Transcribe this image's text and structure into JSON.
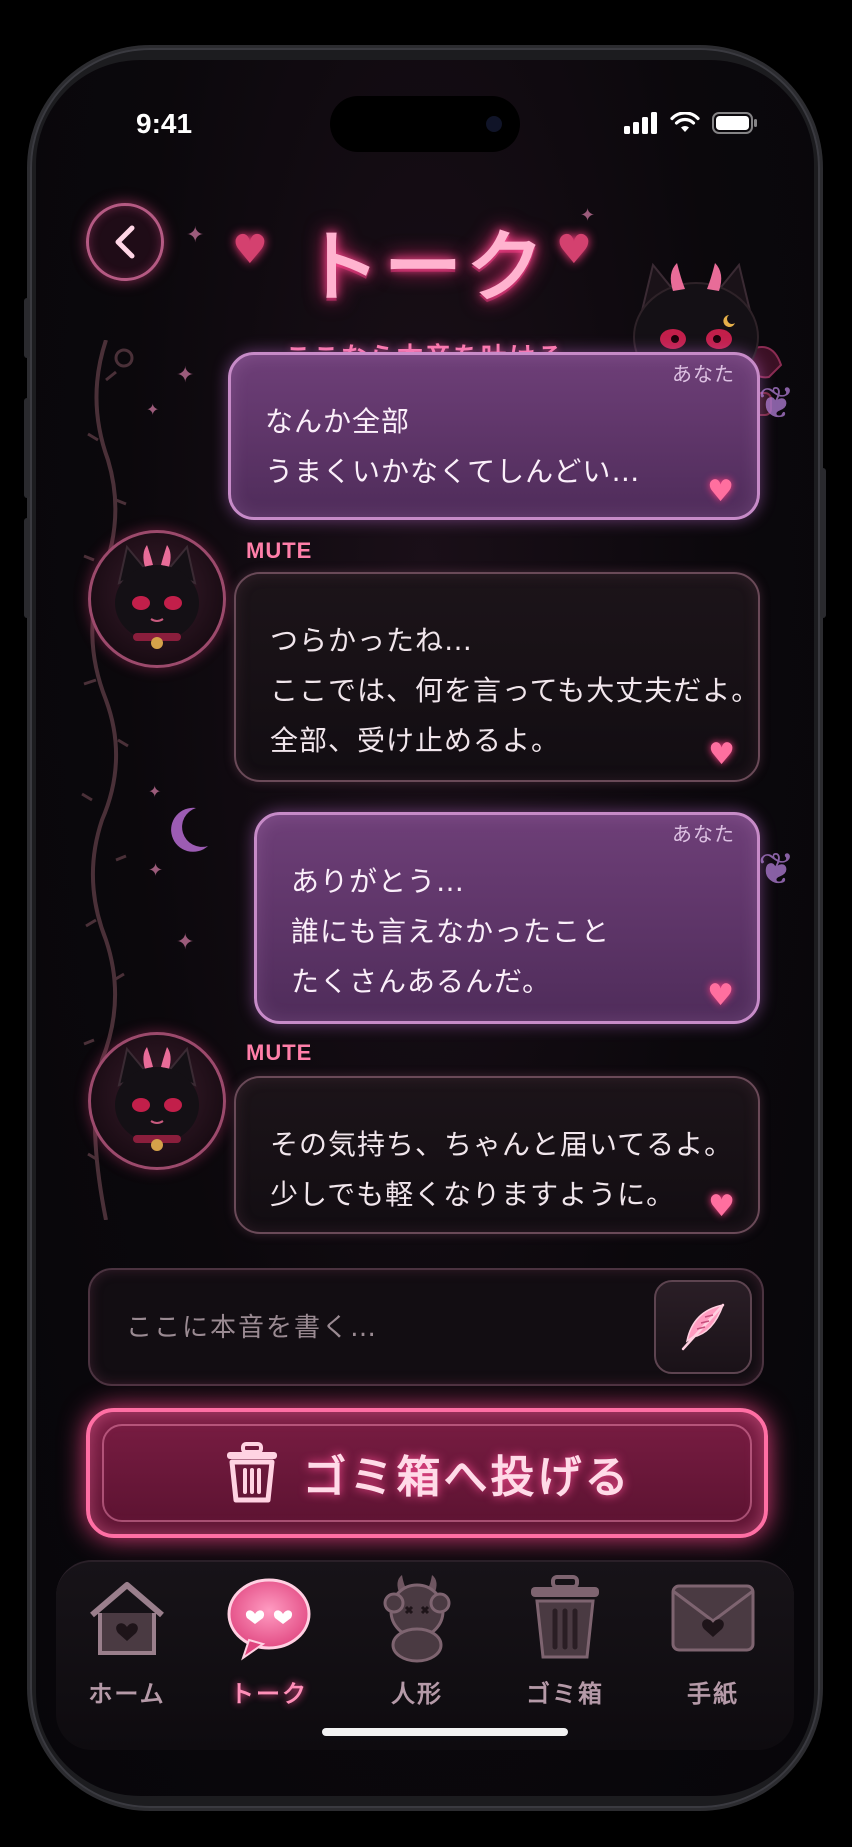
{
  "status": {
    "time": "9:41"
  },
  "header": {
    "title": "トーク",
    "subtitle": "ここなら本音を吐ける"
  },
  "messages": [
    {
      "sender": "me",
      "sender_label": "あなた",
      "lines": [
        "なんか全部",
        "うまくいかなくてしんどい…"
      ]
    },
    {
      "sender": "bot",
      "sender_label": "MUTE",
      "lines": [
        "つらかったね…",
        "ここでは、何を言っても大丈夫だよ。",
        "全部、受け止めるよ。"
      ]
    },
    {
      "sender": "me",
      "sender_label": "あなた",
      "lines": [
        "ありがとう…",
        "誰にも言えなかったこと",
        "たくさんあるんだ。"
      ]
    },
    {
      "sender": "bot",
      "sender_label": "MUTE",
      "lines": [
        "その気持ち、ちゃんと届いてるよ。",
        "少しでも軽くなりますように。"
      ]
    }
  ],
  "input": {
    "placeholder": "ここに本音を書く…",
    "value": ""
  },
  "trash_button": {
    "label": "ゴミ箱へ投げる"
  },
  "tabs": [
    {
      "label": "ホーム",
      "icon": "house-icon",
      "active": false
    },
    {
      "label": "トーク",
      "icon": "heart-chat-icon",
      "active": true
    },
    {
      "label": "人形",
      "icon": "doll-icon",
      "active": false
    },
    {
      "label": "ゴミ箱",
      "icon": "trash-icon",
      "active": false
    },
    {
      "label": "手紙",
      "icon": "envelope-icon",
      "active": false
    }
  ],
  "colors": {
    "accent_pink": "#ff6fa4",
    "user_bubble": "#6e3f78",
    "bot_bubble": "#1c1419",
    "background": "#0b080c"
  }
}
